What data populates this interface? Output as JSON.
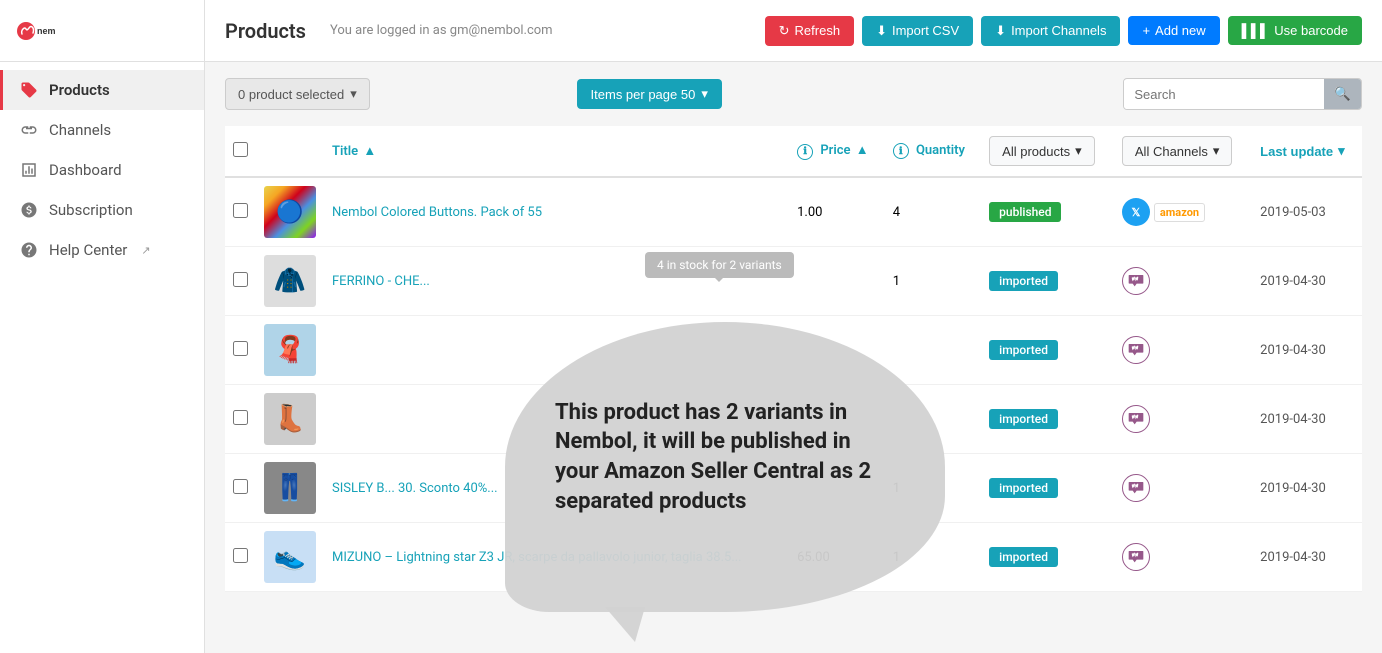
{
  "sidebar": {
    "logo_text": "nembol",
    "items": [
      {
        "id": "products",
        "label": "Products",
        "icon": "tag-icon",
        "active": true
      },
      {
        "id": "channels",
        "label": "Channels",
        "icon": "link-icon",
        "active": false
      },
      {
        "id": "dashboard",
        "label": "Dashboard",
        "icon": "chart-icon",
        "active": false
      },
      {
        "id": "subscription",
        "label": "Subscription",
        "icon": "dollar-icon",
        "active": false
      },
      {
        "id": "help",
        "label": "Help Center",
        "icon": "help-icon",
        "active": false,
        "external": true
      }
    ]
  },
  "topbar": {
    "title": "Products",
    "user_text": "You are logged in as gm@nembol.com",
    "buttons": {
      "refresh": "Refresh",
      "import_csv": "Import CSV",
      "import_channels": "Import Channels",
      "add_new": "Add new",
      "use_barcode": "Use barcode"
    }
  },
  "toolbar": {
    "selected_label": "0 product selected",
    "items_per_page": "Items per page 50",
    "search_placeholder": "Search"
  },
  "table": {
    "columns": {
      "title": "Title",
      "price": "Price",
      "quantity": "Quantity",
      "all_products": "All products",
      "all_channels": "All Channels",
      "last_update": "Last update"
    },
    "tooltip_small": "4 in stock for 2 variants",
    "balloon_text": "This product has 2 variants in Nembol, it will be published in your Amazon Seller Central as 2 separated products",
    "rows": [
      {
        "id": 1,
        "title": "Nembol Colored Buttons. Pack of 55",
        "price": "1.00",
        "quantity": "4",
        "status": "published",
        "status_class": "published",
        "channels": [
          "twitter",
          "amazon"
        ],
        "date": "2019-05-03",
        "thumb_color": "#e8d44d",
        "thumb_emoji": "🔵"
      },
      {
        "id": 2,
        "title": "FERRINO - CHE...",
        "price": "",
        "quantity": "1",
        "status": "imported",
        "status_class": "imported",
        "channels": [
          "woo"
        ],
        "date": "2019-04-30",
        "thumb_color": "#555",
        "thumb_emoji": "🧥"
      },
      {
        "id": 3,
        "title": "",
        "price": "",
        "quantity": "",
        "status": "imported",
        "status_class": "imported",
        "channels": [
          "woo"
        ],
        "date": "2019-04-30",
        "thumb_color": "#7ec8e3",
        "thumb_emoji": "🧣"
      },
      {
        "id": 4,
        "title": "",
        "price": "",
        "quantity": "",
        "status": "imported",
        "status_class": "imported",
        "channels": [
          "woo"
        ],
        "date": "2019-04-30",
        "thumb_color": "#222",
        "thumb_emoji": "👟"
      },
      {
        "id": 5,
        "title": "SISLEY B... 30. Sconto 40%...",
        "price": "",
        "quantity": "1",
        "status": "imported",
        "status_class": "imported",
        "channels": [
          "woo"
        ],
        "date": "2019-04-30",
        "thumb_color": "#333",
        "thumb_emoji": "👖"
      },
      {
        "id": 6,
        "title": "MIZUNO – Lightning star Z3 JR, scarpe da pallavolo junior, taglia 38.5...",
        "price": "65.00",
        "quantity": "1",
        "status": "imported",
        "status_class": "imported",
        "channels": [
          "woo"
        ],
        "date": "2019-04-30",
        "thumb_color": "#4a90e2",
        "thumb_emoji": "👟"
      }
    ]
  },
  "colors": {
    "accent": "#17a2b8",
    "danger": "#e63946",
    "success": "#28a745",
    "primary": "#007bff"
  }
}
